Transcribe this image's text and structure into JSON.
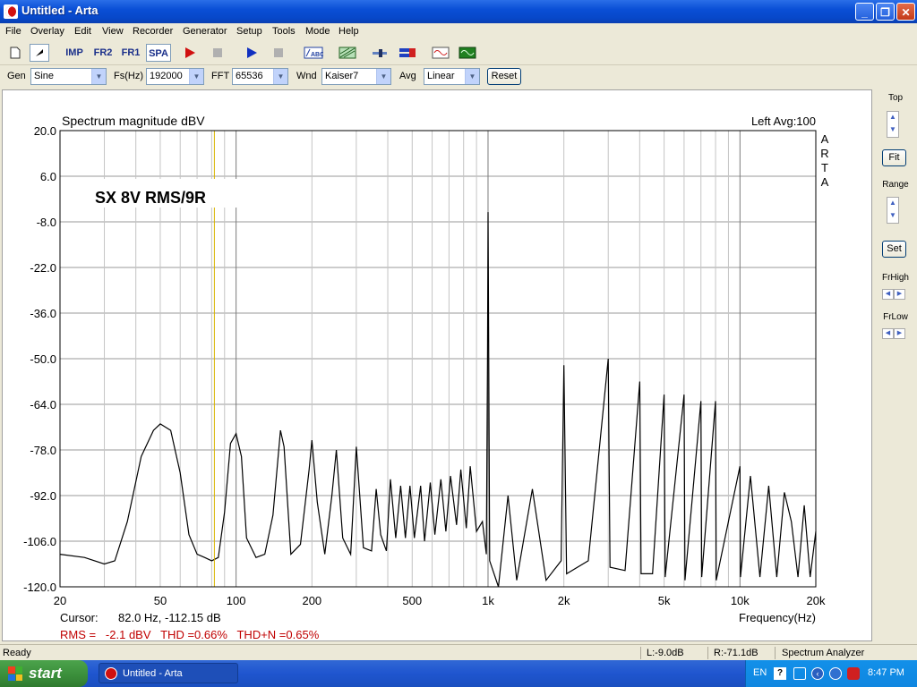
{
  "window": {
    "title": "Untitled - Arta",
    "minimize": "_",
    "maximize": "❐",
    "close": "✕"
  },
  "menu": [
    "File",
    "Overlay",
    "Edit",
    "View",
    "Recorder",
    "Generator",
    "Setup",
    "Tools",
    "Mode",
    "Help"
  ],
  "toolbar": {
    "imp": "IMP",
    "fr2": "FR2",
    "fr1": "FR1",
    "spa": "SPA"
  },
  "params": {
    "gen_label": "Gen",
    "gen_value": "Sine",
    "fs_label": "Fs(Hz)",
    "fs_value": "192000",
    "fft_label": "FFT",
    "fft_value": "65536",
    "wnd_label": "Wnd",
    "wnd_value": "Kaiser7",
    "avg_label": "Avg",
    "avg_value": "Linear",
    "reset": "Reset"
  },
  "plot": {
    "title": "Spectrum magnitude dBV",
    "channel_avg": "Left  Avg:100",
    "brand": [
      "A",
      "R",
      "T",
      "A"
    ],
    "annotation": "SX 8V RMS/9R",
    "cursor_label": "Cursor:",
    "cursor_value": "82.0 Hz, -112.15 dB",
    "freq_label": "Frequency(Hz)",
    "stats": "RMS =   -2.1 dBV   THD =0.66%   THD+N =0.65%"
  },
  "chart_data": {
    "type": "line",
    "title": "Spectrum magnitude dBV",
    "xlabel": "Frequency(Hz)",
    "ylabel": "",
    "xscale": "log",
    "xlim": [
      20,
      20000
    ],
    "ylim": [
      -120,
      20
    ],
    "x_ticks": [
      20,
      50,
      100,
      200,
      500,
      1000,
      2000,
      5000,
      10000,
      20000
    ],
    "x_tick_labels": [
      "20",
      "50",
      "100",
      "200",
      "500",
      "1k",
      "2k",
      "5k",
      "10k",
      "20k"
    ],
    "y_ticks": [
      20,
      6,
      -8,
      -22,
      -36,
      -50,
      -64,
      -78,
      -92,
      -106,
      -120
    ],
    "y_tick_labels": [
      "20.0",
      "6.0",
      "-8.0",
      "-22.0",
      "-36.0",
      "-50.0",
      "-64.0",
      "-78.0",
      "-92.0",
      "-106.0",
      "-120.0"
    ],
    "grid": true,
    "cursor_freq": 82.0,
    "series": [
      {
        "values": [
          [
            20,
            -110
          ],
          [
            25,
            -111
          ],
          [
            30,
            -113
          ],
          [
            33,
            -112
          ],
          [
            37,
            -100
          ],
          [
            42,
            -80
          ],
          [
            47,
            -72
          ],
          [
            50,
            -70
          ],
          [
            55,
            -72
          ],
          [
            60,
            -85
          ],
          [
            65,
            -104
          ],
          [
            70,
            -110
          ],
          [
            75,
            -111
          ],
          [
            80,
            -112
          ],
          [
            85,
            -111
          ],
          [
            90,
            -97
          ],
          [
            95,
            -76
          ],
          [
            100,
            -73
          ],
          [
            105,
            -80
          ],
          [
            110,
            -105
          ],
          [
            120,
            -111
          ],
          [
            130,
            -110
          ],
          [
            140,
            -98
          ],
          [
            150,
            -72
          ],
          [
            155,
            -77
          ],
          [
            165,
            -110
          ],
          [
            180,
            -107
          ],
          [
            195,
            -84
          ],
          [
            200,
            -75
          ],
          [
            210,
            -94
          ],
          [
            225,
            -110
          ],
          [
            240,
            -92
          ],
          [
            250,
            -78
          ],
          [
            265,
            -105
          ],
          [
            285,
            -110
          ],
          [
            300,
            -77
          ],
          [
            320,
            -108
          ],
          [
            345,
            -109
          ],
          [
            360,
            -90
          ],
          [
            375,
            -104
          ],
          [
            395,
            -109
          ],
          [
            410,
            -87
          ],
          [
            430,
            -105
          ],
          [
            450,
            -89
          ],
          [
            470,
            -105
          ],
          [
            490,
            -89
          ],
          [
            510,
            -105
          ],
          [
            540,
            -89
          ],
          [
            560,
            -106
          ],
          [
            590,
            -88
          ],
          [
            615,
            -104
          ],
          [
            650,
            -87
          ],
          [
            680,
            -103
          ],
          [
            710,
            -86
          ],
          [
            750,
            -101
          ],
          [
            780,
            -84
          ],
          [
            820,
            -102
          ],
          [
            850,
            -83
          ],
          [
            900,
            -103
          ],
          [
            950,
            -100
          ],
          [
            985,
            -110
          ],
          [
            995,
            -50
          ],
          [
            1000,
            -5
          ],
          [
            1005,
            -40
          ],
          [
            1015,
            -112
          ],
          [
            1100,
            -120
          ],
          [
            1200,
            -92
          ],
          [
            1300,
            -118
          ],
          [
            1500,
            -90
          ],
          [
            1700,
            -118
          ],
          [
            1950,
            -112
          ],
          [
            2000,
            -52
          ],
          [
            2050,
            -116
          ],
          [
            2500,
            -112
          ],
          [
            3000,
            -50
          ],
          [
            3050,
            -114
          ],
          [
            3500,
            -115
          ],
          [
            4000,
            -57
          ],
          [
            4050,
            -116
          ],
          [
            4500,
            -116
          ],
          [
            5000,
            -61
          ],
          [
            5050,
            -117
          ],
          [
            6000,
            -61
          ],
          [
            6050,
            -118
          ],
          [
            7000,
            -63
          ],
          [
            7050,
            -117
          ],
          [
            8000,
            -63
          ],
          [
            8050,
            -118
          ],
          [
            9000,
            -100
          ],
          [
            10000,
            -83
          ],
          [
            10050,
            -117
          ],
          [
            11000,
            -86
          ],
          [
            12000,
            -117
          ],
          [
            13000,
            -89
          ],
          [
            14000,
            -117
          ],
          [
            15000,
            -91
          ],
          [
            16000,
            -100
          ],
          [
            17000,
            -117
          ],
          [
            18000,
            -95
          ],
          [
            19000,
            -117
          ],
          [
            20000,
            -103
          ]
        ]
      }
    ]
  },
  "side": {
    "top": "Top",
    "fit": "Fit",
    "range": "Range",
    "set": "Set",
    "frhigh": "FrHigh",
    "frlow": "FrLow"
  },
  "status": {
    "ready": "Ready",
    "left": "L:-9.0dB",
    "right": "R:-71.1dB",
    "mode": "Spectrum Analyzer"
  },
  "taskbar": {
    "start": "start",
    "task": "Untitled - Arta",
    "lang": "EN",
    "time": "8:47 PM"
  }
}
